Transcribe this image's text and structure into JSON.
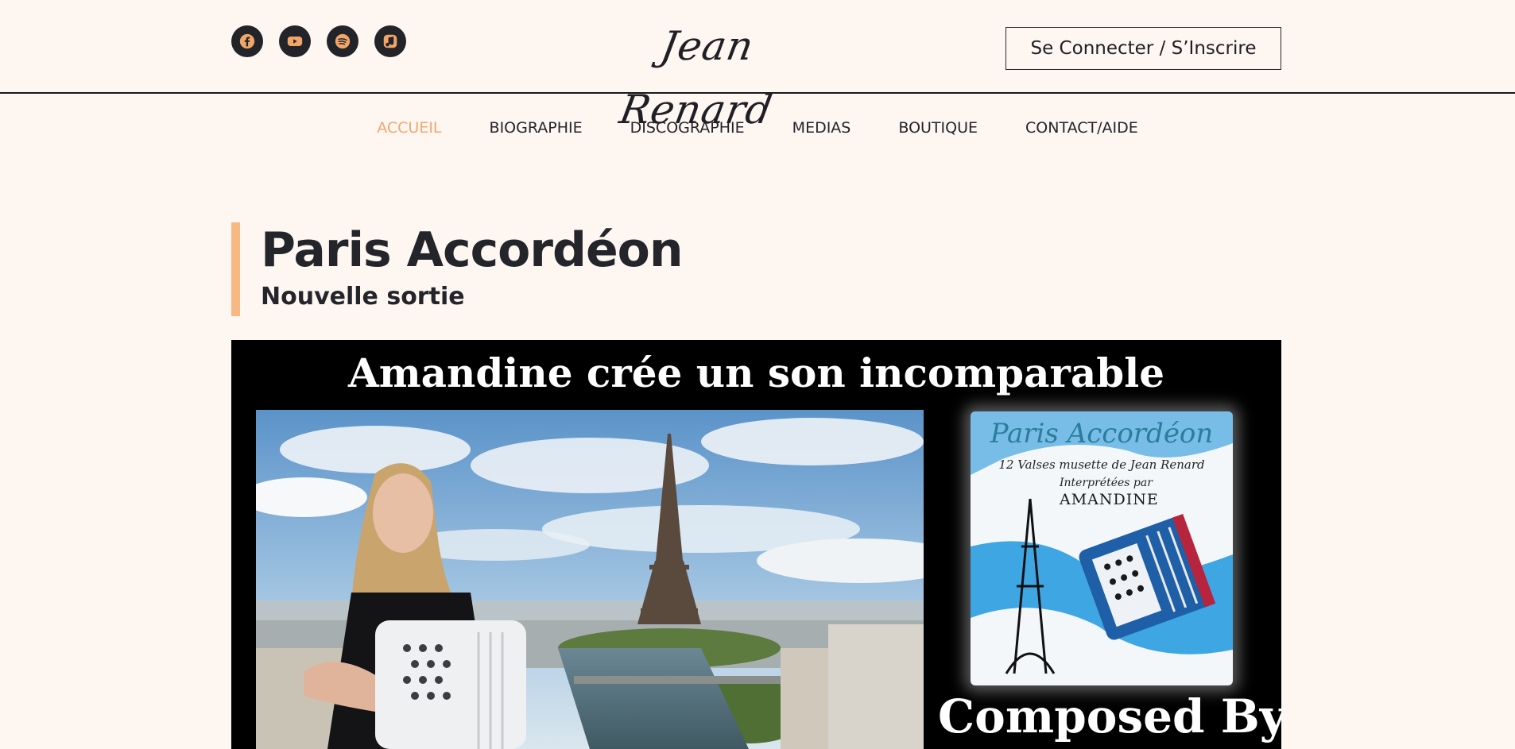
{
  "header": {
    "logo": "Jean Renard",
    "login_label": "Se Connecter / S’Inscrire",
    "socials": [
      {
        "icon": "facebook-icon"
      },
      {
        "icon": "youtube-icon"
      },
      {
        "icon": "spotify-icon"
      },
      {
        "icon": "music-icon"
      }
    ]
  },
  "nav": {
    "items": [
      {
        "label": "ACCUEIL",
        "active": true
      },
      {
        "label": "BIOGRAPHIE"
      },
      {
        "label": "DISCOGRAPHIE"
      },
      {
        "label": "MEDIAS"
      },
      {
        "label": "BOUTIQUE"
      },
      {
        "label": "CONTACT/AIDE"
      }
    ]
  },
  "hero": {
    "title": "Paris Accordéon",
    "subtitle": "Nouvelle sortie"
  },
  "banner": {
    "caption": "Amandine crée un son incomparable",
    "album_title": "Paris Accordéon",
    "album_subtitle": "12 Valses musette de Jean Renard",
    "album_interpreted": "Interprétées par",
    "album_artist": "AMANDINE",
    "composed_by": "Composed By"
  },
  "colors": {
    "background": "#fdf6f1",
    "accent": "#f2a86b",
    "accent_bar": "#f8b883",
    "text": "#24252b"
  }
}
